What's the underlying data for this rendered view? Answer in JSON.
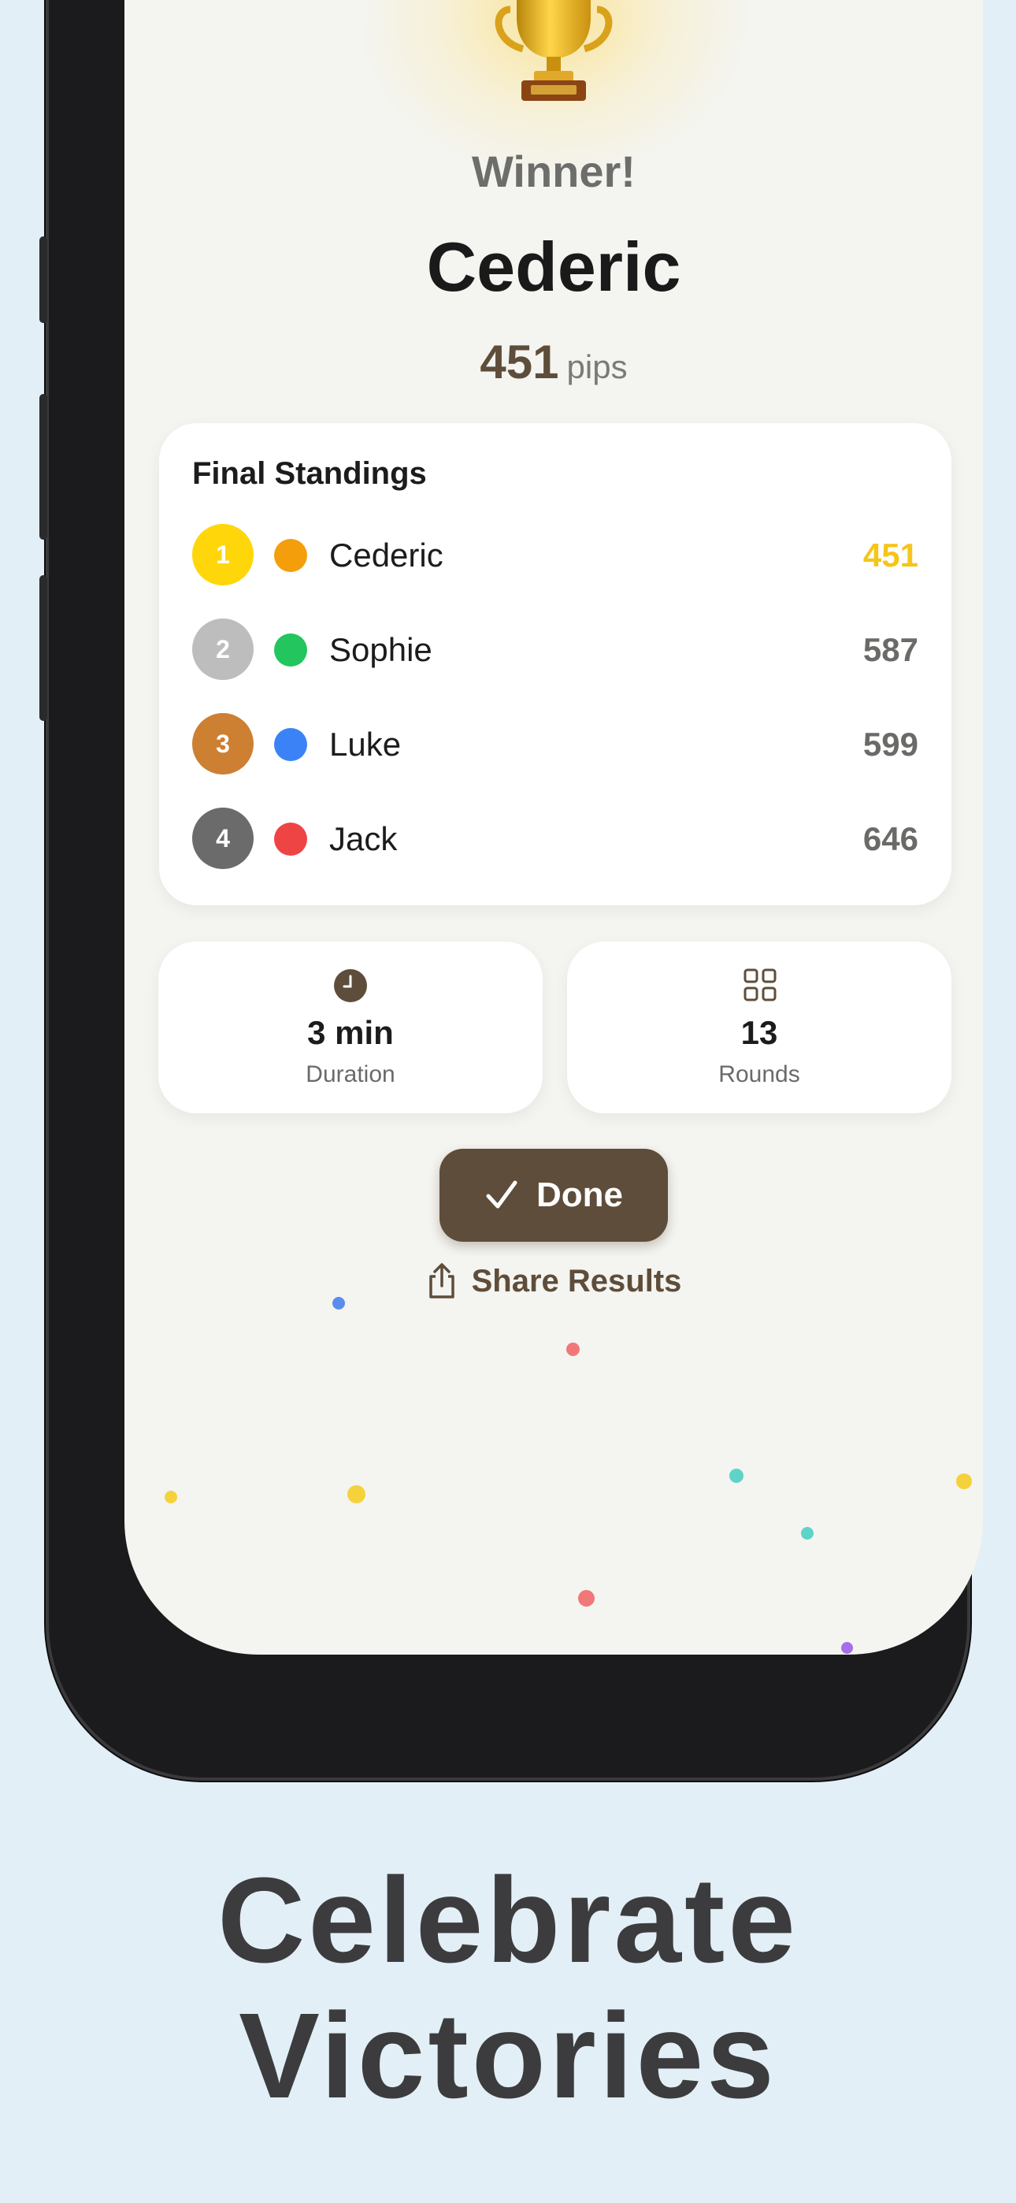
{
  "winner": {
    "label": "Winner!",
    "name": "Cederic",
    "score": "451",
    "unit": "pips"
  },
  "standings": {
    "title": "Final Standings",
    "rows": [
      {
        "rank": "1",
        "name": "Cederic",
        "score": "451",
        "rank_color": "#FFD60A",
        "dot_color": "#F59E0B",
        "score_color": "#F5C518"
      },
      {
        "rank": "2",
        "name": "Sophie",
        "score": "587",
        "rank_color": "#BDBDBD",
        "dot_color": "#22C55E",
        "score_color": "#6A6A68"
      },
      {
        "rank": "3",
        "name": "Luke",
        "score": "599",
        "rank_color": "#CD7F32",
        "dot_color": "#3B82F6",
        "score_color": "#6A6A68"
      },
      {
        "rank": "4",
        "name": "Jack",
        "score": "646",
        "rank_color": "#6B6B6B",
        "dot_color": "#EF4444",
        "score_color": "#6A6A68"
      }
    ]
  },
  "stats": {
    "duration": {
      "value": "3 min",
      "label": "Duration",
      "icon": "clock-icon"
    },
    "rounds": {
      "value": "13",
      "label": "Rounds",
      "icon": "grid-icon"
    }
  },
  "actions": {
    "done_label": "Done",
    "share_label": "Share Results"
  },
  "headline": {
    "line1": "Celebrate",
    "line2": "Victories"
  },
  "colors": {
    "accent": "#5E4D3A",
    "background": "#E3EFF6",
    "screen": "#F4F4F0"
  }
}
